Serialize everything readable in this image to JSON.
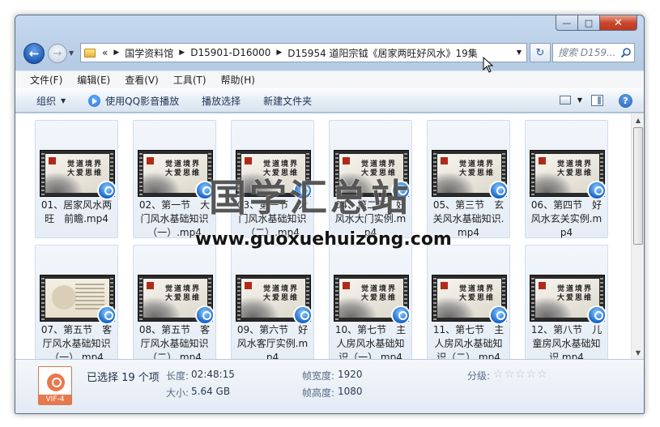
{
  "window": {
    "controls": {
      "minimize": "—",
      "maximize": "□",
      "close": "✕"
    }
  },
  "nav": {
    "back_icon": "←",
    "forward_icon": "→",
    "history_caret": "▼",
    "breadcrumb_overflow": "«",
    "breadcrumbs": [
      "国学资料馆",
      "D15901-D16000",
      "D15954 道阳宗钺《居家两旺好风水》19集"
    ],
    "refresh_icon": "↻",
    "search_placeholder": "搜索 D159..."
  },
  "menu": [
    "文件(F)",
    "编辑(E)",
    "查看(V)",
    "工具(T)",
    "帮助(H)"
  ],
  "toolbar": {
    "organize": "组织",
    "play_with_qq": "使用QQ影音播放",
    "play_selection": "播放选择",
    "new_folder": "新建文件夹",
    "help": "?"
  },
  "files": [
    {
      "name": "01、居家风水两旺　前瞻.mp4",
      "thumb_text": "觉道境界\n大爱思维",
      "variant": "film"
    },
    {
      "name": "02、第一节　大门风水基础知识（一）.mp4",
      "thumb_text": "觉道境界\n大爱思维",
      "variant": "film"
    },
    {
      "name": "03、第一节　大门风水基础知识（二）.mp4",
      "thumb_text": "觉道境界\n大爱思维",
      "variant": "film"
    },
    {
      "name": "04、第二节　好风水大门实例.mp4",
      "thumb_text": "觉道境界\n大爱思维",
      "variant": "film"
    },
    {
      "name": "05、第三节　玄关风水基础知识.mp4",
      "thumb_text": "觉道境界\n大爱思维",
      "variant": "film"
    },
    {
      "name": "06、第四节　好风水玄关实例.mp4",
      "thumb_text": "觉道境界\n大爱思维",
      "variant": "film"
    },
    {
      "name": "07、第五节　客厅风水基础知识（一）.mp4",
      "thumb_text": "",
      "variant": "room"
    },
    {
      "name": "08、第五节　客厅风水基础知识（二）.mp4",
      "thumb_text": "觉道境界\n大爱思维",
      "variant": "film"
    },
    {
      "name": "09、第六节　好风水客厅实例.mp4",
      "thumb_text": "觉道境界\n大爱思维",
      "variant": "film"
    },
    {
      "name": "10、第七节　主人房风水基础知识（一）.mp4",
      "thumb_text": "觉道境界\n大爱思维",
      "variant": "film"
    },
    {
      "name": "11、第七节　主人房风水基础知识（二）.mp4",
      "thumb_text": "觉道境界\n大爱思维",
      "variant": "film"
    },
    {
      "name": "12、第八节　儿童房风水基础知识.mp4",
      "thumb_text": "觉道境界\n大爱思维",
      "variant": "film"
    }
  ],
  "watermark": {
    "cn": "国学汇总站",
    "url": "www.guoxuehuizong.com"
  },
  "details": {
    "icon_ext": "VIF-4",
    "selected": "已选择 19 个项",
    "length_label": "长度:",
    "length": "02:48:15",
    "size_label": "大小:",
    "size": "5.64 GB",
    "frame_width_label": "帧宽度:",
    "frame_width": "1920",
    "frame_height_label": "帧高度:",
    "frame_height": "1080",
    "rating_label": "分级:",
    "rating": 0
  }
}
